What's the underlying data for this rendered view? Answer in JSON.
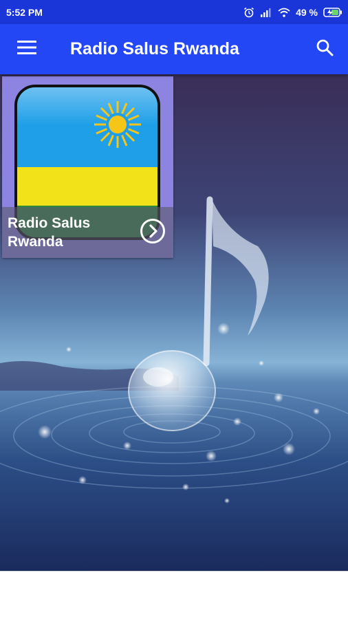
{
  "status_bar": {
    "time": "5:52 PM",
    "battery": "49 %",
    "icons": [
      "alarm-icon",
      "signal-icon",
      "wifi-icon",
      "battery-charging-icon"
    ]
  },
  "app_bar": {
    "title": "Radio Salus Rwanda",
    "menu_icon": "hamburger-menu-icon",
    "search_icon": "search-icon",
    "color": "#2447f5"
  },
  "stations": [
    {
      "label": "Radio Salus Rwanda",
      "label_line1": "Radio Salus",
      "label_line2": "Rwanda",
      "icon": "rwanda-flag-icon",
      "action_icon": "chevron-right-circle-icon"
    }
  ],
  "colors": {
    "status_bar": "#1b36d8",
    "card_bg": "#8c84e0",
    "flag_blue": "#1f9fe8",
    "flag_yellow": "#f2e21a",
    "flag_green": "#2d8a3a",
    "sun": "#f5c518"
  }
}
